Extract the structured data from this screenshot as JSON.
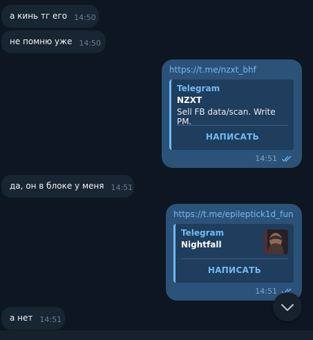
{
  "messages": [
    {
      "text": "а кинь тг его",
      "time": "14:50"
    },
    {
      "text": "не помню уже",
      "time": "14:50"
    },
    {
      "link": "https://t.me/nzxt_bhf",
      "preview_site": "Telegram",
      "preview_title": "NZXT",
      "preview_desc": "Sell FB data/scan. Write PM.",
      "button": "НАПИСАТЬ",
      "time": "14:51"
    },
    {
      "text": "да, он в блоке у меня",
      "time": "14:51"
    },
    {
      "link": "https://t.me/epileptick1d_fun",
      "preview_site": "Telegram",
      "preview_title": "Nightfall",
      "button": "НАПИСАТЬ",
      "time": "14:51"
    },
    {
      "text": "а нет",
      "time": "14:51"
    }
  ],
  "colors": {
    "background": "#0e1621",
    "incoming_bubble": "#182533",
    "outgoing_bubble": "#2b5278",
    "accent": "#71baf5"
  },
  "icons": {
    "read_receipt": "double-check-icon",
    "scroll_down": "chevron-down-icon"
  }
}
